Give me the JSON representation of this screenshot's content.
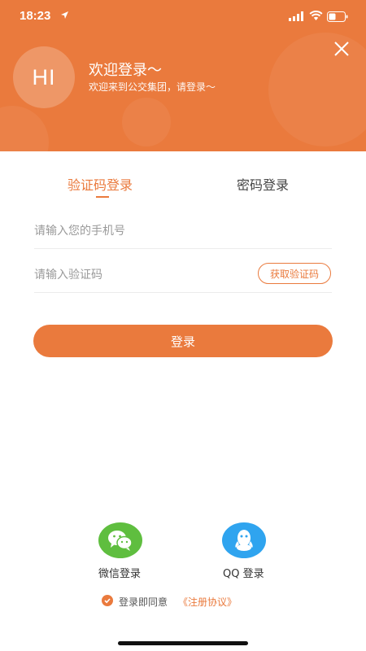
{
  "status_bar": {
    "time": "18:23",
    "icons": [
      "location-arrow-icon",
      "signal-icon",
      "wifi-icon",
      "battery-icon"
    ]
  },
  "header": {
    "avatar_text": "HI",
    "title": "欢迎登录～",
    "subtitle": "欢迎来到公交集团，请登录～",
    "close_icon": "close-icon",
    "background_color": "#EA7A3D"
  },
  "tabs": [
    {
      "label": "验证码登录",
      "active": true
    },
    {
      "label": "密码登录",
      "active": false
    }
  ],
  "form": {
    "phone_placeholder": "请输入您的手机号",
    "phone_value": "",
    "code_placeholder": "请输入验证码",
    "code_value": "",
    "get_code_label": "获取验证码",
    "submit_label": "登录"
  },
  "social": {
    "wechat_label": "微信登录",
    "wechat_icon": "wechat-icon",
    "wechat_color": "#5FBE3F",
    "qq_label": "QQ 登录",
    "qq_icon": "qq-icon",
    "qq_color": "#2FA4EF"
  },
  "agreement": {
    "checked": true,
    "text": "登录即同意",
    "link": "《注册协议》"
  },
  "colors": {
    "accent": "#EA7A3D"
  }
}
